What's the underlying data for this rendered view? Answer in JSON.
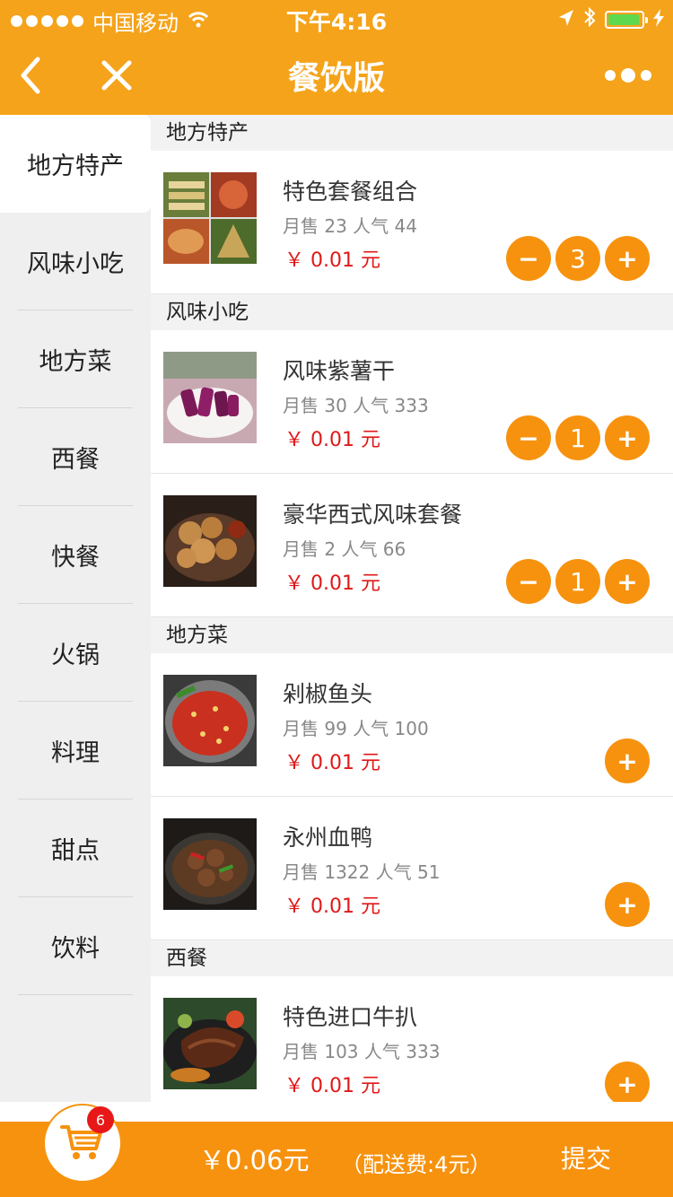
{
  "status_bar": {
    "carrier": "中国移动",
    "time": "下午4:16",
    "battery_level": 0.95
  },
  "nav": {
    "title": "餐饮版",
    "back_icon": "back-arrow-icon",
    "close_icon": "close-icon",
    "more_icon": "more-icon"
  },
  "sidebar": {
    "items": [
      {
        "label": "地方特产",
        "active": true
      },
      {
        "label": "风味小吃"
      },
      {
        "label": "地方菜"
      },
      {
        "label": "西餐"
      },
      {
        "label": "快餐"
      },
      {
        "label": "火锅"
      },
      {
        "label": "料理"
      },
      {
        "label": "甜点"
      },
      {
        "label": "饮料"
      }
    ]
  },
  "sections": [
    {
      "title": "地方特产",
      "items": [
        {
          "name": "特色套餐组合",
          "stats": "月售 23 人气 44",
          "price": "￥ 0.01 元",
          "qty": "3"
        }
      ]
    },
    {
      "title": "风味小吃",
      "items": [
        {
          "name": "风味紫薯干",
          "stats": "月售 30 人气 333",
          "price": "￥ 0.01 元",
          "qty": "1"
        },
        {
          "name": "豪华西式风味套餐",
          "stats": "月售 2 人气 66",
          "price": "￥ 0.01 元",
          "qty": "1"
        }
      ]
    },
    {
      "title": "地方菜",
      "items": [
        {
          "name": "剁椒鱼头",
          "stats": "月售 99 人气 100",
          "price": "￥ 0.01 元"
        },
        {
          "name": "永州血鸭",
          "stats": "月售 1322 人气 51",
          "price": "￥ 0.01 元"
        }
      ]
    },
    {
      "title": "西餐",
      "items": [
        {
          "name": "特色进口牛扒",
          "stats": "月售 103 人气 333",
          "price": "￥ 0.01 元"
        }
      ]
    }
  ],
  "controls": {
    "minus": "−",
    "plus": "+"
  },
  "cart": {
    "badge": "6",
    "total": "￥0.06元",
    "fee": "（配送费:4元）",
    "submit": "提交"
  },
  "colors": {
    "brand": "#f5a31a",
    "button": "#f7920e",
    "price": "#e01818",
    "badge": "#e81818"
  }
}
